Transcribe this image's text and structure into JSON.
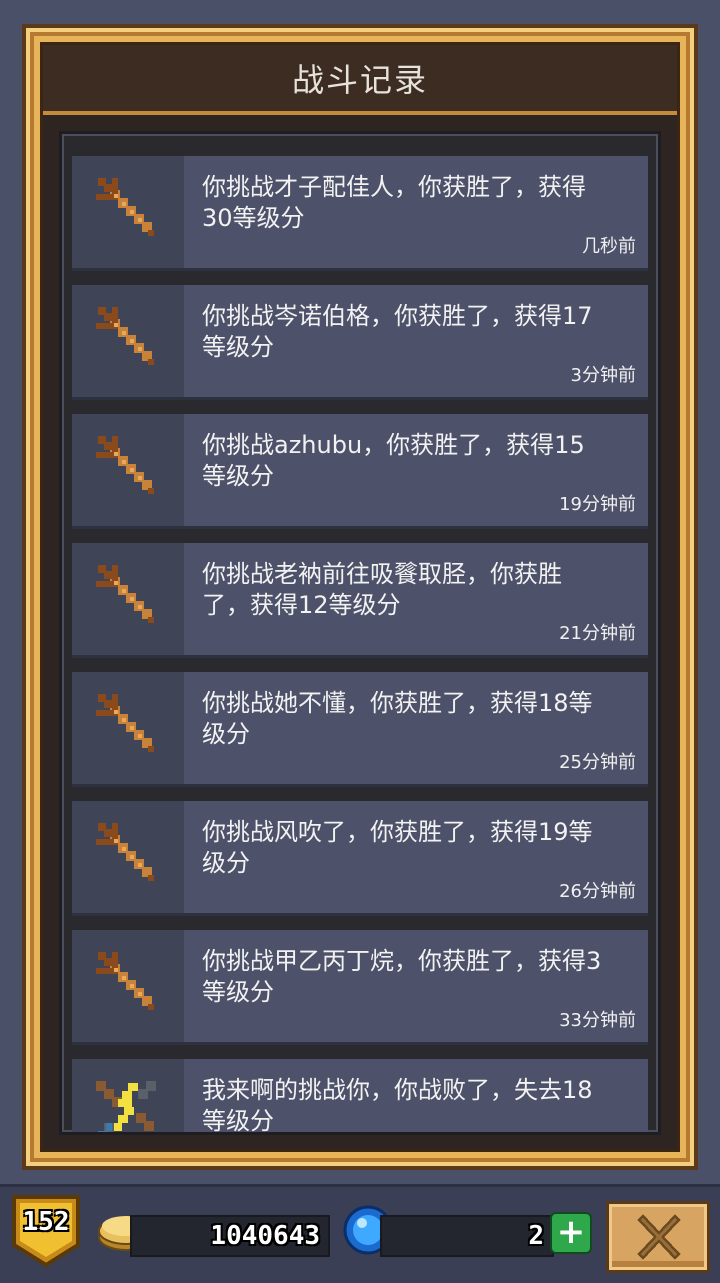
{
  "panel": {
    "title": "战斗记录"
  },
  "records": [
    {
      "icon": "sword-icon",
      "text": "你挑战才子配佳人，你获胜了，获得30等级分",
      "time": "几秒前"
    },
    {
      "icon": "sword-icon",
      "text": "你挑战岑诺伯格，你获胜了，获得17等级分",
      "time": "3分钟前"
    },
    {
      "icon": "sword-icon",
      "text": "你挑战azhubu，你获胜了，获得15等级分",
      "time": "19分钟前"
    },
    {
      "icon": "sword-icon",
      "text": "你挑战老衲前往吸餮取胫，你获胜了，获得12等级分",
      "time": "21分钟前"
    },
    {
      "icon": "sword-icon",
      "text": "你挑战她不懂，你获胜了，获得18等级分",
      "time": "25分钟前"
    },
    {
      "icon": "sword-icon",
      "text": "你挑战风吹了，你获胜了，获得19等级分",
      "time": "26分钟前"
    },
    {
      "icon": "sword-icon",
      "text": "你挑战甲乙丙丁烷，你获胜了，获得3等级分",
      "time": "33分钟前"
    },
    {
      "icon": "crossed-swords-lightning-icon",
      "text": "我来啊的挑战你，你战败了，失去18等级分",
      "time": ""
    }
  ],
  "hud": {
    "level": "152",
    "coins": "1040643",
    "gems": "2",
    "add_gem_symbol": "+"
  },
  "colors": {
    "frame_gold": "#e8b45a",
    "entry_bg": "#4d5169",
    "page_bg": "#4a5068"
  }
}
